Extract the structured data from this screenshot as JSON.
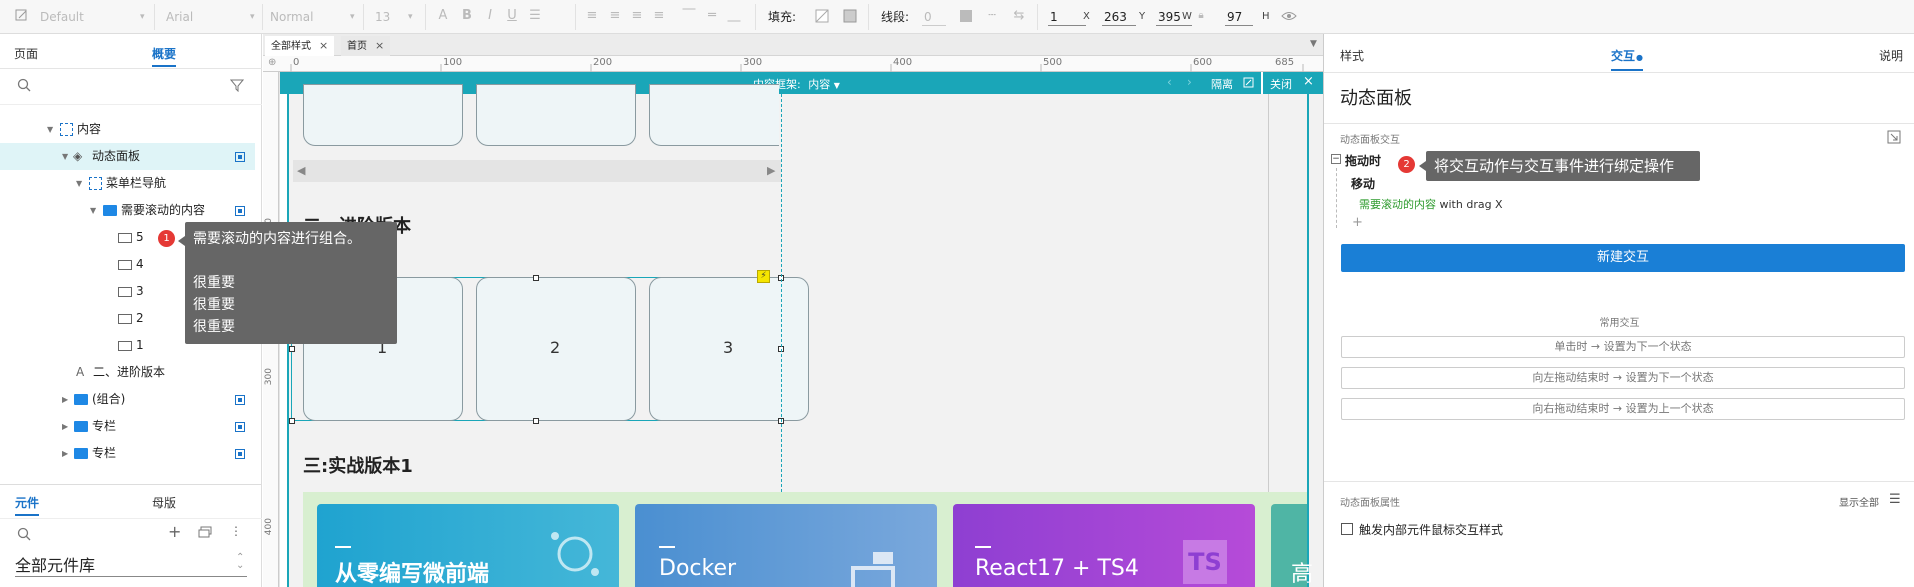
{
  "toolbar": {
    "style_select": "Default",
    "font_select": "Arial",
    "weight_select": "Normal",
    "size_select": "13",
    "fill_label": "填充:",
    "line_label": "线段:",
    "line_value": "0",
    "x_value": "1",
    "x_unit": "X",
    "y_value": "263",
    "y_unit": "Y",
    "w_value": "395",
    "w_unit": "W",
    "h_value": "97",
    "h_unit": "H"
  },
  "left": {
    "tabs": [
      "页面",
      "概要"
    ],
    "active_tab": "概要",
    "tree": [
      {
        "label": "内容",
        "kind": "dash"
      },
      {
        "label": "动态面板",
        "kind": "layers"
      },
      {
        "label": "菜单栏导航",
        "kind": "dash"
      },
      {
        "label": "需要滚动的内容",
        "kind": "folder"
      },
      {
        "label": "5",
        "kind": "rect"
      },
      {
        "label": "4",
        "kind": "rect"
      },
      {
        "label": "3",
        "kind": "rect"
      },
      {
        "label": "2",
        "kind": "rect"
      },
      {
        "label": "1",
        "kind": "rect"
      },
      {
        "label": "二、进阶版本",
        "kind": "text"
      },
      {
        "label": "(组合)",
        "kind": "folder"
      },
      {
        "label": "专栏",
        "kind": "folder"
      },
      {
        "label": "专栏",
        "kind": "folder"
      }
    ],
    "bottom_tabs": [
      "元件",
      "母版"
    ],
    "library_label": "全部元件库"
  },
  "canvas": {
    "doc_tabs": [
      "全部样式",
      "首页"
    ],
    "ruler_ticks": [
      "0",
      "100",
      "200",
      "300",
      "400",
      "500",
      "600",
      "685"
    ],
    "ruler_v_ticks": [
      "200",
      "300",
      "400"
    ],
    "editbar_title": "内容框架:",
    "editbar_state": "内容",
    "isolate_label": "隔离",
    "close_label": "关闭",
    "section2_heading": "二、进阶版本",
    "section3_heading": "三:实战版本1",
    "cards": [
      "1",
      "2",
      "3"
    ],
    "course_cards": [
      "从零编写微前端",
      "Docker",
      "React17 + TS4",
      "高"
    ]
  },
  "tooltip1": {
    "badge": "1",
    "lines": [
      "需要滚动的内容进行组合。",
      "",
      "很重要",
      "很重要",
      "很重要"
    ]
  },
  "tooltip2": {
    "badge": "2",
    "text": "将交互动作与交互事件进行绑定操作"
  },
  "right": {
    "tabs": [
      "样式",
      "交互",
      "说明"
    ],
    "active_tab": "交互",
    "panel_title": "动态面板",
    "section_interactions": "动态面板交互",
    "event_name": "拖动时",
    "action_name": "移动",
    "action_target": "需要滚动的内容",
    "action_detail": "with drag X",
    "add_symbol": "+",
    "new_interaction": "新建交互",
    "common_label": "常用交互",
    "common_items": [
      "单击时 → 设置为下一个状态",
      "向左拖动结束时 → 设置为下一个状态",
      "向右拖动结束时 → 设置为上一个状态"
    ],
    "props_label": "动态面板属性",
    "show_all": "显示全部",
    "checkbox_label": "触发内部元件鼠标交互样式"
  },
  "colors": {
    "accent": "#1a73c8",
    "teal_bar": "#1aa6b8",
    "primary_button": "#1a7fd6",
    "badge_red": "#e53935",
    "green_target": "#2e9b2e"
  }
}
